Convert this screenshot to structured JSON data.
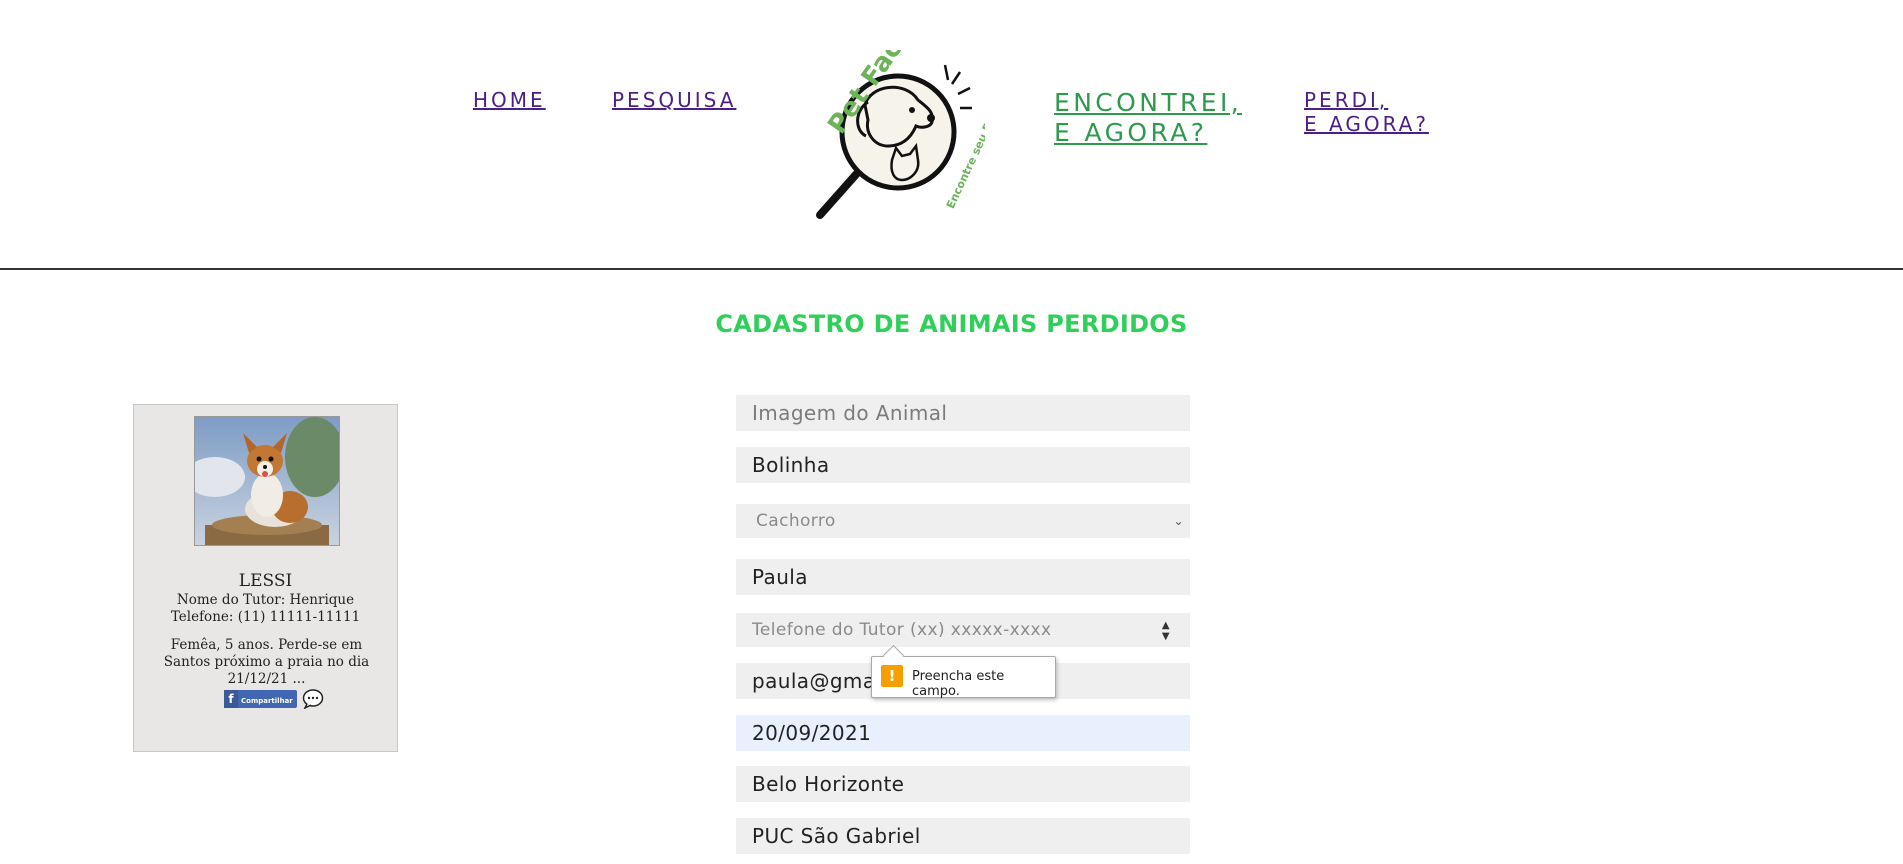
{
  "nav": {
    "home": "HOME",
    "pesquisa": "PESQUISA",
    "encontrei_line1": "ENCONTREI,",
    "encontrei_line2": "E AGORA?",
    "perdi_line1": "PERDI,",
    "perdi_line2": "E AGORA?"
  },
  "logo": {
    "title": "Pet Face",
    "tagline": "Encontre seu Pet",
    "icon": "magnifier-dog-cat-logo"
  },
  "form": {
    "title": "CADASTRO DE ANIMAIS PERDIDOS",
    "image_placeholder": "Imagem do Animal",
    "pet_name": "Bolinha",
    "species_selected": "Cachorro",
    "tutor_name": "Paula",
    "phone_placeholder": "Telefone do Tutor (xx) xxxxx-xxxx",
    "email": "paula@gma",
    "date": "20/09/2021",
    "city": "Belo Horizonte",
    "neighborhood": "PUC São Gabriel"
  },
  "tooltip": {
    "text": "Preencha este campo.",
    "icon": "warning-icon"
  },
  "card": {
    "name": "LESSI",
    "tutor": "Nome do Tutor: Henrique",
    "phone": "Telefone: (11) 11111-11111",
    "description": "Femêa, 5 anos. Perde-se em Santos próximo a praia no dia 21/12/21 ...",
    "share_label": "Compartilhar"
  },
  "colors": {
    "nav_link": "#4b1f86",
    "nav_active": "#2e9a4c",
    "title_green": "#2fcf5a",
    "field_bg": "#efefef",
    "field_focused_bg": "#e8f0fe"
  }
}
